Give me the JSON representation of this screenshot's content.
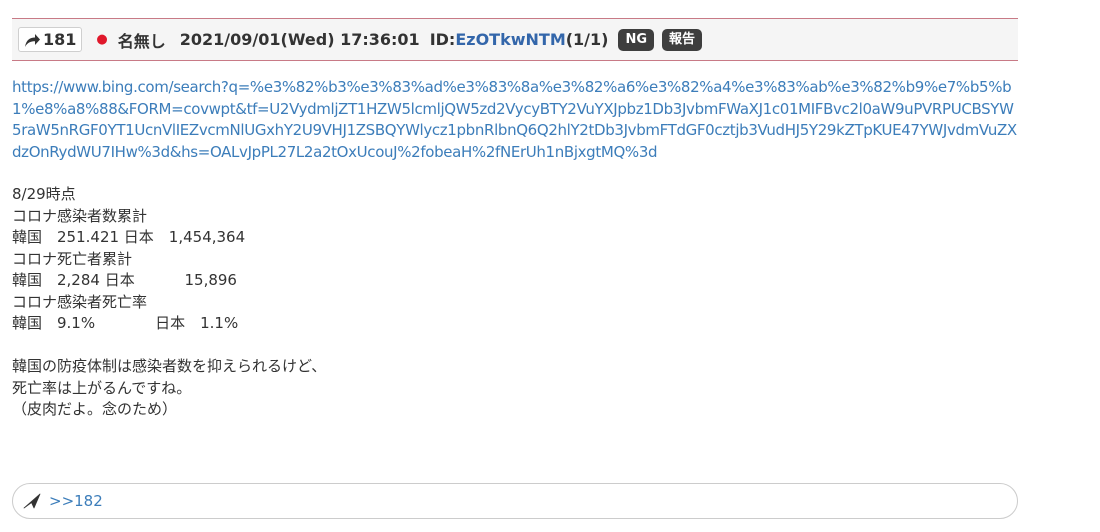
{
  "post": {
    "number": "181",
    "name": "名無し",
    "date": "2021/09/01(Wed) 17:36:01",
    "id_prefix": "ID:",
    "id": "EzOTkwNTM",
    "id_count": "(1/1)",
    "ng_label": "NG",
    "report_label": "報告",
    "url": "https://www.bing.com/search?q=%e3%82%b3%e3%83%ad%e3%83%8a%e3%82%a6%e3%82%a4%e3%83%ab%e3%82%b9%e7%b5%b1%e8%a8%88&FORM=covwpt&tf=U2VydmljZT1HZW5lcmljQW5zd2VycyBTY2VuYXJpbz1Db3JvbmFWaXJ1c01MIFBvc2l0aW9uPVRPUCBSYW5raW5nRGF0YT1UcnVlIEZvcmNlUGxhY2U9VHJ1ZSBQYWlycz1pbnRlbnQ6Q2hlY2tDb3JvbmFTdGF0cztjb3VudHJ5Y29kZTpKUE47YWJvdmVuZXdzOnRydWU7IHw%3d&hs=OALvJpPL27L2a2tOxUcouJ%2fobeaH%2fNErUh1nBjxgtMQ%3d",
    "body_lines": [
      "8/29時点",
      "コロナ感染者数累計",
      "韓国　251.421 日本　1,454,364",
      "コロナ死亡者累計",
      "韓国　2,284 日本　　　 15,896",
      "コロナ感染者死亡率",
      "韓国　9.1%　　　　日本　1.1%",
      "",
      "韓国の防疫体制は感染者数を抑えられるけど、",
      "死亡率は上がるんですね。",
      "（皮肉だよ。念のため）"
    ]
  },
  "reply_bar": {
    "link_text": ">>182"
  },
  "colors": {
    "link": "#3c7dba",
    "id_link": "#3366aa",
    "dot": "#e0182b",
    "header_border": "#c87a86",
    "tag_bg": "#3e3e3e"
  },
  "icons": {
    "post_number": "share-arrow-icon",
    "reply": "paper-plane-icon"
  }
}
